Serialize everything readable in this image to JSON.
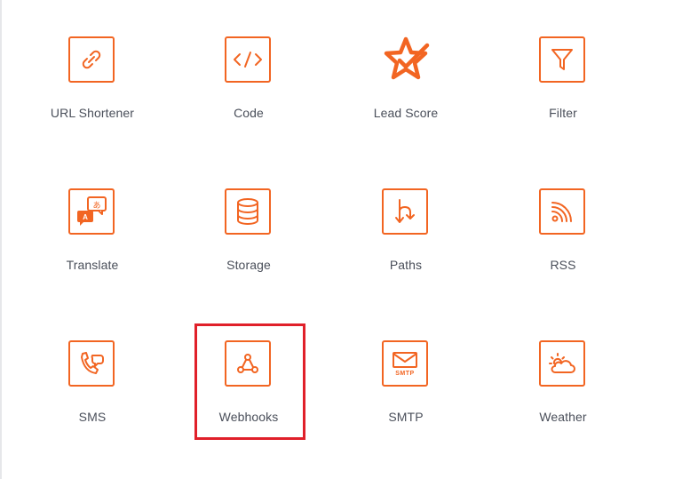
{
  "colors": {
    "accent": "#f26522",
    "label": "#4a4f5a",
    "highlight": "#e0202a"
  },
  "apps": [
    {
      "label": "URL Shortener",
      "icon": "link-icon"
    },
    {
      "label": "Code",
      "icon": "code-icon"
    },
    {
      "label": "Lead Score",
      "icon": "star-check-icon"
    },
    {
      "label": "Filter",
      "icon": "filter-icon"
    },
    {
      "label": "Translate",
      "icon": "translate-icon"
    },
    {
      "label": "Storage",
      "icon": "database-icon"
    },
    {
      "label": "Paths",
      "icon": "paths-icon"
    },
    {
      "label": "RSS",
      "icon": "rss-icon"
    },
    {
      "label": "SMS",
      "icon": "phone-chat-icon"
    },
    {
      "label": "Webhooks",
      "icon": "webhooks-icon"
    },
    {
      "label": "SMTP",
      "icon": "envelope-icon"
    },
    {
      "label": "Weather",
      "icon": "weather-icon"
    }
  ],
  "icon_text": {
    "translate_a": "A",
    "translate_kana": "あ",
    "smtp": "SMTP"
  },
  "selected": "Webhooks"
}
